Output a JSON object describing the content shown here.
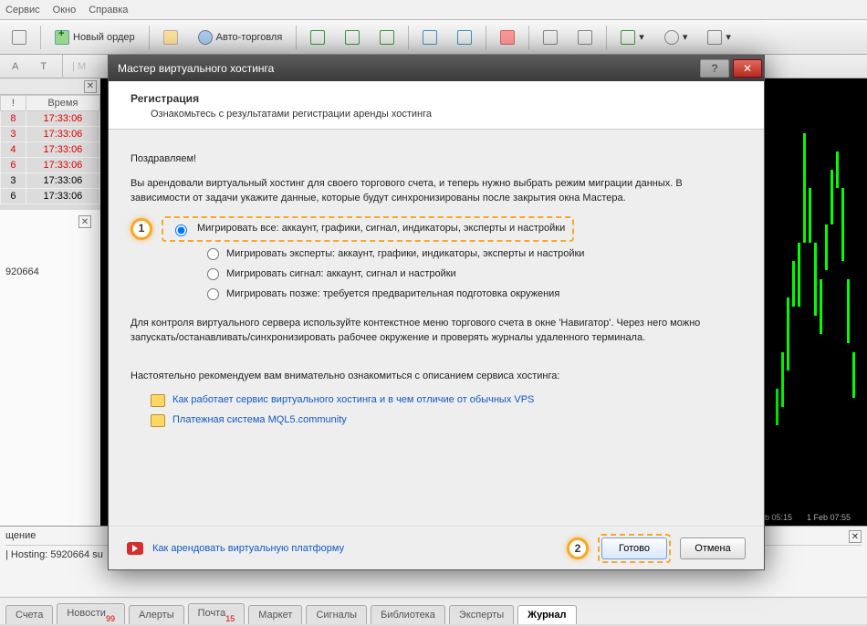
{
  "menubar": {
    "items": [
      "Сервис",
      "Окно",
      "Справка"
    ]
  },
  "toolbar": {
    "new_order": "Новый ордер",
    "auto_trade": "Авто-торговля"
  },
  "drawbar": {
    "items": [
      "A",
      "T"
    ]
  },
  "time_table": {
    "headers": [
      "!",
      "Время"
    ],
    "rows": [
      {
        "n": "8",
        "t": "17:33:06",
        "red": true
      },
      {
        "n": "3",
        "t": "17:33:06",
        "red": true
      },
      {
        "n": "4",
        "t": "17:33:06",
        "red": true
      },
      {
        "n": "6",
        "t": "17:33:06",
        "red": true
      },
      {
        "n": "3",
        "t": "17:33:06",
        "red": false
      },
      {
        "n": "6",
        "t": "17:33:06",
        "red": false
      }
    ]
  },
  "nav_panel": {
    "label": "920664"
  },
  "bottom_panel": {
    "header": "щение",
    "line1": "| Hosting: 5920664 su"
  },
  "chart": {
    "times": [
      "b 05:15",
      "1 Feb 07:55"
    ]
  },
  "tabs": [
    {
      "label": "Счета"
    },
    {
      "label": "Новости",
      "badge": "99"
    },
    {
      "label": "Алерты"
    },
    {
      "label": "Почта",
      "badge": "15"
    },
    {
      "label": "Маркет"
    },
    {
      "label": "Сигналы"
    },
    {
      "label": "Библиотека"
    },
    {
      "label": "Эксперты"
    },
    {
      "label": "Журнал",
      "active": true
    }
  ],
  "dialog": {
    "title": "Мастер виртуального хостинга",
    "h": "Регистрация",
    "h_sub": "Ознакомьтесь с результатами регистрации аренды хостинга",
    "congrats": "Поздравляем!",
    "p1": "Вы арендовали виртуальный хостинг для своего торгового счета, и теперь нужно выбрать режим миграции данных. В зависимости от задачи укажите данные, которые будут синхронизированы после закрытия окна Мастера.",
    "radios": [
      "Мигрировать все: аккаунт, графики, сигнал, индикаторы, эксперты и настройки",
      "Мигрировать эксперты: аккаунт, графики, индикаторы, эксперты и настройки",
      "Мигрировать сигнал: аккаунт, сигнал и настройки",
      "Мигрировать позже: требуется предварительная подготовка окружения"
    ],
    "p2": "Для контроля виртуального сервера используйте контекстное меню торгового счета в окне 'Навигатор'. Через него можно запускать/останавливать/синхронизировать рабочее окружение и проверять журналы удаленного терминала.",
    "p3": "Настоятельно рекомендуем вам внимательно ознакомиться с описанием сервиса хостинга:",
    "links": [
      "Как работает сервис виртуального хостинга и в чем отличие от обычных VPS",
      "Платежная система MQL5.community"
    ],
    "yt_link": "Как арендовать виртуальную платформу",
    "callout1": "1",
    "callout2": "2",
    "done": "Готово",
    "cancel": "Отмена",
    "help": "?",
    "close": "✕"
  }
}
